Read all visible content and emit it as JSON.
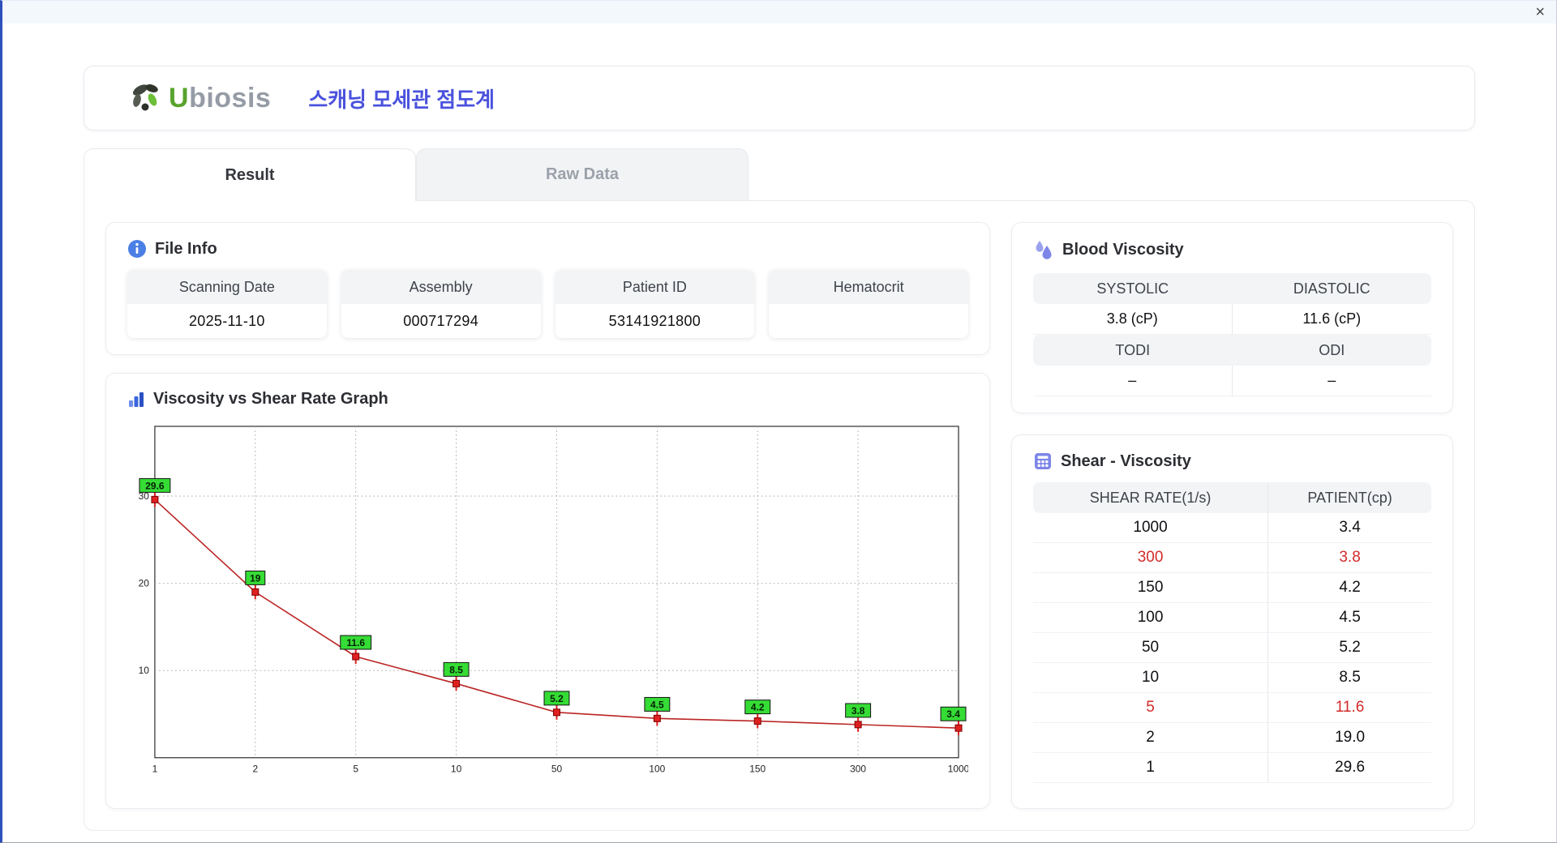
{
  "window": {
    "close_icon": "×"
  },
  "header": {
    "brand_first": "U",
    "brand_rest": "biosis",
    "title": "스캐닝 모세관 점도계"
  },
  "tabs": [
    {
      "label": "Result",
      "active": true
    },
    {
      "label": "Raw Data",
      "active": false
    }
  ],
  "file_info": {
    "title": "File Info",
    "fields": [
      {
        "label": "Scanning Date",
        "value": "2025-11-10"
      },
      {
        "label": "Assembly",
        "value": "000717294"
      },
      {
        "label": "Patient ID",
        "value": "53141921800"
      },
      {
        "label": "Hematocrit",
        "value": ""
      }
    ]
  },
  "blood_viscosity": {
    "title": "Blood Viscosity",
    "rows": [
      {
        "labels": [
          "SYSTOLIC",
          "DIASTOLIC"
        ],
        "values": [
          "3.8 (cP)",
          "11.6 (cP)"
        ]
      },
      {
        "labels": [
          "TODI",
          "ODI"
        ],
        "values": [
          "–",
          "–"
        ]
      }
    ]
  },
  "shear_viscosity": {
    "title": "Shear - Viscosity",
    "headers": [
      "SHEAR RATE(1/s)",
      "PATIENT(cp)"
    ],
    "rows": [
      {
        "shear": "1000",
        "patient": "3.4",
        "highlight": false
      },
      {
        "shear": "300",
        "patient": "3.8",
        "highlight": true
      },
      {
        "shear": "150",
        "patient": "4.2",
        "highlight": false
      },
      {
        "shear": "100",
        "patient": "4.5",
        "highlight": false
      },
      {
        "shear": "50",
        "patient": "5.2",
        "highlight": false
      },
      {
        "shear": "10",
        "patient": "8.5",
        "highlight": false
      },
      {
        "shear": "5",
        "patient": "11.6",
        "highlight": true
      },
      {
        "shear": "2",
        "patient": "19.0",
        "highlight": false
      },
      {
        "shear": "1",
        "patient": "29.6",
        "highlight": false
      }
    ]
  },
  "chart_data": {
    "type": "line",
    "title": "Viscosity vs Shear Rate Graph",
    "x_categories": [
      "1",
      "2",
      "5",
      "10",
      "50",
      "100",
      "150",
      "300",
      "1000"
    ],
    "values": [
      29.6,
      19,
      11.6,
      8.5,
      5.2,
      4.5,
      4.2,
      3.8,
      3.4
    ],
    "point_labels": [
      "29.6",
      "19",
      "11.6",
      "8.5",
      "5.2",
      "4.5",
      "4.2",
      "3.8",
      "3.4"
    ],
    "yticks": [
      10,
      20,
      30
    ],
    "ylim": [
      0,
      38
    ],
    "xlabel": "",
    "ylabel": "",
    "grid": true,
    "legend": "none",
    "line_color": "#bb2525",
    "marker_color": "#e02020",
    "label_bg": "#35dc35"
  },
  "colors": {
    "accent_blue": "#4a52dd",
    "brand_green": "#58a32c",
    "highlight_red": "#d22a2a",
    "label_green": "#35dc35"
  }
}
